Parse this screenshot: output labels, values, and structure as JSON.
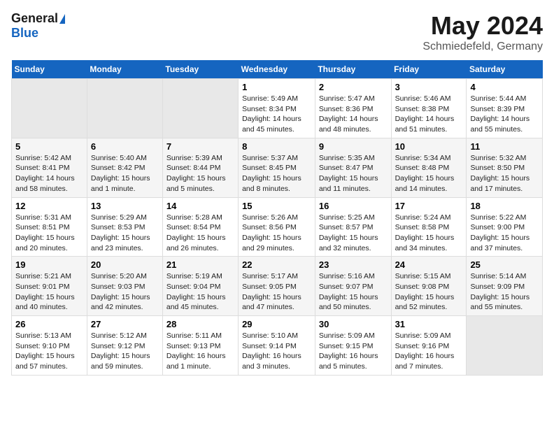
{
  "header": {
    "logo_general": "General",
    "logo_blue": "Blue",
    "title": "May 2024",
    "location": "Schmiedefeld, Germany"
  },
  "days_of_week": [
    "Sunday",
    "Monday",
    "Tuesday",
    "Wednesday",
    "Thursday",
    "Friday",
    "Saturday"
  ],
  "weeks": [
    [
      {
        "day": "",
        "empty": true
      },
      {
        "day": "",
        "empty": true
      },
      {
        "day": "",
        "empty": true
      },
      {
        "day": "1",
        "sunrise": "5:49 AM",
        "sunset": "8:34 PM",
        "daylight": "14 hours and 45 minutes."
      },
      {
        "day": "2",
        "sunrise": "5:47 AM",
        "sunset": "8:36 PM",
        "daylight": "14 hours and 48 minutes."
      },
      {
        "day": "3",
        "sunrise": "5:46 AM",
        "sunset": "8:38 PM",
        "daylight": "14 hours and 51 minutes."
      },
      {
        "day": "4",
        "sunrise": "5:44 AM",
        "sunset": "8:39 PM",
        "daylight": "14 hours and 55 minutes."
      }
    ],
    [
      {
        "day": "5",
        "sunrise": "5:42 AM",
        "sunset": "8:41 PM",
        "daylight": "14 hours and 58 minutes."
      },
      {
        "day": "6",
        "sunrise": "5:40 AM",
        "sunset": "8:42 PM",
        "daylight": "15 hours and 1 minute."
      },
      {
        "day": "7",
        "sunrise": "5:39 AM",
        "sunset": "8:44 PM",
        "daylight": "15 hours and 5 minutes."
      },
      {
        "day": "8",
        "sunrise": "5:37 AM",
        "sunset": "8:45 PM",
        "daylight": "15 hours and 8 minutes."
      },
      {
        "day": "9",
        "sunrise": "5:35 AM",
        "sunset": "8:47 PM",
        "daylight": "15 hours and 11 minutes."
      },
      {
        "day": "10",
        "sunrise": "5:34 AM",
        "sunset": "8:48 PM",
        "daylight": "15 hours and 14 minutes."
      },
      {
        "day": "11",
        "sunrise": "5:32 AM",
        "sunset": "8:50 PM",
        "daylight": "15 hours and 17 minutes."
      }
    ],
    [
      {
        "day": "12",
        "sunrise": "5:31 AM",
        "sunset": "8:51 PM",
        "daylight": "15 hours and 20 minutes."
      },
      {
        "day": "13",
        "sunrise": "5:29 AM",
        "sunset": "8:53 PM",
        "daylight": "15 hours and 23 minutes."
      },
      {
        "day": "14",
        "sunrise": "5:28 AM",
        "sunset": "8:54 PM",
        "daylight": "15 hours and 26 minutes."
      },
      {
        "day": "15",
        "sunrise": "5:26 AM",
        "sunset": "8:56 PM",
        "daylight": "15 hours and 29 minutes."
      },
      {
        "day": "16",
        "sunrise": "5:25 AM",
        "sunset": "8:57 PM",
        "daylight": "15 hours and 32 minutes."
      },
      {
        "day": "17",
        "sunrise": "5:24 AM",
        "sunset": "8:58 PM",
        "daylight": "15 hours and 34 minutes."
      },
      {
        "day": "18",
        "sunrise": "5:22 AM",
        "sunset": "9:00 PM",
        "daylight": "15 hours and 37 minutes."
      }
    ],
    [
      {
        "day": "19",
        "sunrise": "5:21 AM",
        "sunset": "9:01 PM",
        "daylight": "15 hours and 40 minutes."
      },
      {
        "day": "20",
        "sunrise": "5:20 AM",
        "sunset": "9:03 PM",
        "daylight": "15 hours and 42 minutes."
      },
      {
        "day": "21",
        "sunrise": "5:19 AM",
        "sunset": "9:04 PM",
        "daylight": "15 hours and 45 minutes."
      },
      {
        "day": "22",
        "sunrise": "5:17 AM",
        "sunset": "9:05 PM",
        "daylight": "15 hours and 47 minutes."
      },
      {
        "day": "23",
        "sunrise": "5:16 AM",
        "sunset": "9:07 PM",
        "daylight": "15 hours and 50 minutes."
      },
      {
        "day": "24",
        "sunrise": "5:15 AM",
        "sunset": "9:08 PM",
        "daylight": "15 hours and 52 minutes."
      },
      {
        "day": "25",
        "sunrise": "5:14 AM",
        "sunset": "9:09 PM",
        "daylight": "15 hours and 55 minutes."
      }
    ],
    [
      {
        "day": "26",
        "sunrise": "5:13 AM",
        "sunset": "9:10 PM",
        "daylight": "15 hours and 57 minutes."
      },
      {
        "day": "27",
        "sunrise": "5:12 AM",
        "sunset": "9:12 PM",
        "daylight": "15 hours and 59 minutes."
      },
      {
        "day": "28",
        "sunrise": "5:11 AM",
        "sunset": "9:13 PM",
        "daylight": "16 hours and 1 minute."
      },
      {
        "day": "29",
        "sunrise": "5:10 AM",
        "sunset": "9:14 PM",
        "daylight": "16 hours and 3 minutes."
      },
      {
        "day": "30",
        "sunrise": "5:09 AM",
        "sunset": "9:15 PM",
        "daylight": "16 hours and 5 minutes."
      },
      {
        "day": "31",
        "sunrise": "5:09 AM",
        "sunset": "9:16 PM",
        "daylight": "16 hours and 7 minutes."
      },
      {
        "day": "",
        "empty": true
      }
    ]
  ],
  "labels": {
    "sunrise_prefix": "Sunrise:",
    "sunset_prefix": "Sunset:",
    "daylight_prefix": "Daylight:"
  }
}
